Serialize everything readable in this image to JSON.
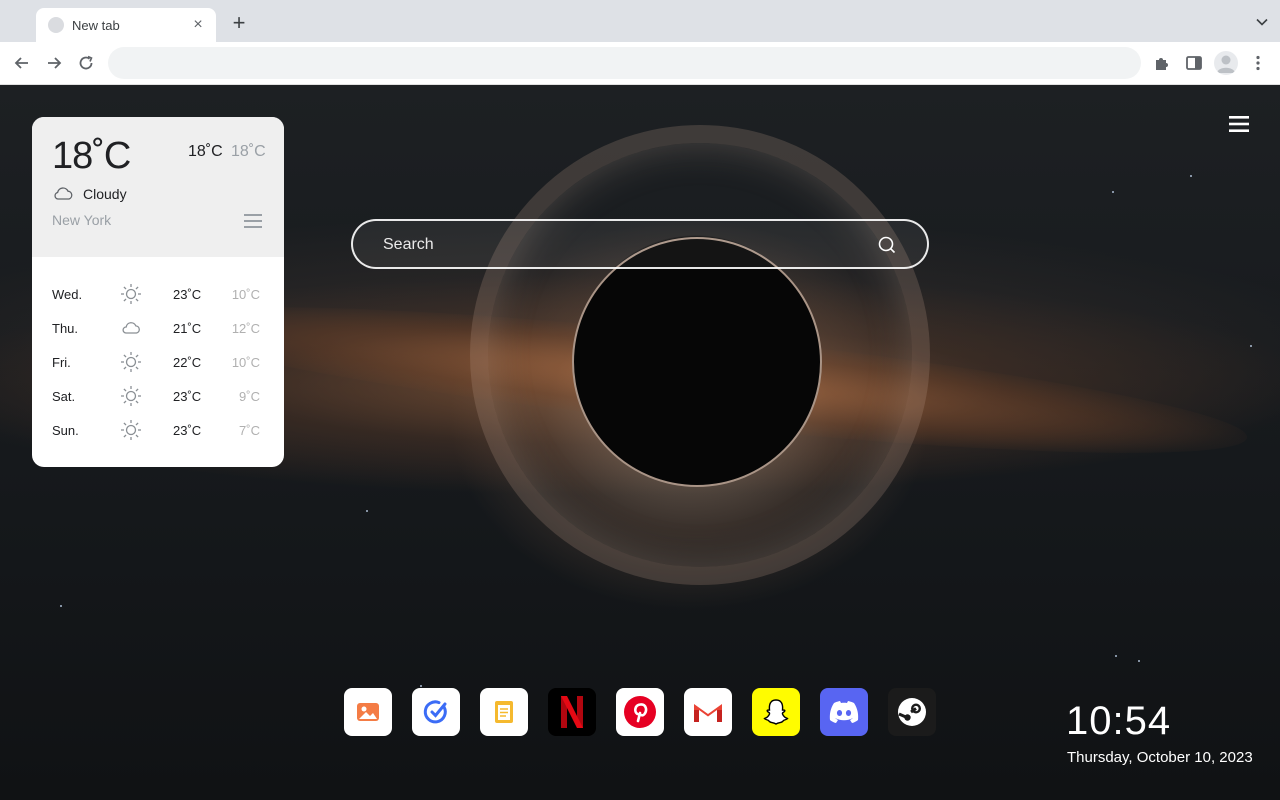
{
  "browser": {
    "tab_title": "New tab",
    "omnibox_value": "",
    "omnibox_placeholder": ""
  },
  "weather": {
    "current_temp": "18˚C",
    "condition": "Cloudy",
    "condition_icon": "cloud-icon",
    "city": "New York",
    "unit_primary": "18˚C",
    "unit_secondary": "18˚C",
    "forecast": [
      {
        "day": "Wed.",
        "icon": "sun-icon",
        "high": "23˚C",
        "low": "10˚C"
      },
      {
        "day": "Thu.",
        "icon": "cloud-icon",
        "high": "21˚C",
        "low": "12˚C"
      },
      {
        "day": "Fri.",
        "icon": "sun-icon",
        "high": "22˚C",
        "low": "10˚C"
      },
      {
        "day": "Sat.",
        "icon": "sun-icon",
        "high": "23˚C",
        "low": "9˚C"
      },
      {
        "day": "Sun.",
        "icon": "sun-icon",
        "high": "23˚C",
        "low": "7˚C"
      }
    ]
  },
  "search": {
    "placeholder": "Search"
  },
  "dock": {
    "apps": [
      {
        "name": "gallery",
        "icon": "image-icon",
        "bg": "#ffffff"
      },
      {
        "name": "tasks",
        "icon": "check-circle-icon",
        "bg": "#ffffff"
      },
      {
        "name": "notes",
        "icon": "note-icon",
        "bg": "#ffffff"
      },
      {
        "name": "netflix",
        "icon": "netflix-icon",
        "bg": "#000000"
      },
      {
        "name": "pinterest",
        "icon": "pinterest-icon",
        "bg": "#ffffff"
      },
      {
        "name": "gmail",
        "icon": "gmail-icon",
        "bg": "#ffffff"
      },
      {
        "name": "snapchat",
        "icon": "snapchat-icon",
        "bg": "#fffc00"
      },
      {
        "name": "discord",
        "icon": "discord-icon",
        "bg": "#5865f2"
      },
      {
        "name": "steam",
        "icon": "steam-icon",
        "bg": "#1b1b1b"
      }
    ]
  },
  "clock": {
    "time": "10:54",
    "date": "Thursday, October 10, 2023"
  },
  "colors": {
    "accent_gallery": "#e8643a",
    "accent_tasks": "#3b6cf6",
    "accent_notes": "#e8a92c",
    "netflix_red": "#e50914",
    "pinterest_red": "#e60023",
    "discord_blurple": "#5865f2",
    "snapchat_yellow": "#fffc00"
  }
}
